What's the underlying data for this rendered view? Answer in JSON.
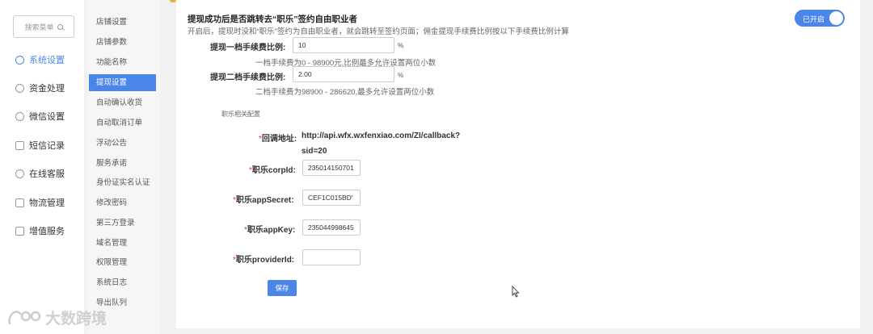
{
  "sidebar": {
    "search_placeholder": "搜索菜单",
    "items": [
      {
        "label": "系统设置",
        "icon": "gear-icon"
      },
      {
        "label": "资金处理",
        "icon": "money-icon"
      },
      {
        "label": "微信设置",
        "icon": "wechat-icon"
      },
      {
        "label": "短信记录",
        "icon": "message-icon"
      },
      {
        "label": "在线客服",
        "icon": "headset-icon"
      },
      {
        "label": "物流管理",
        "icon": "truck-icon"
      },
      {
        "label": "增值服务",
        "icon": "chart-icon"
      }
    ]
  },
  "submenu": {
    "items": [
      "店铺设置",
      "店铺参数",
      "功能名称",
      "提现设置",
      "自动确认收货",
      "自动取消订单",
      "浮动公告",
      "服务承诺",
      "身份证实名认证",
      "修改密码",
      "第三方登录",
      "域名管理",
      "权限管理",
      "系统日志",
      "导出队列"
    ]
  },
  "form": {
    "title": "提现成功后是否跳转去“职乐”签约自由职业者",
    "description": "开启后，提现时没和“职乐”签约为自由职业者，就会跳转至签约页面；佣金提现手续费比例按以下手续费比例计算",
    "toggle_label": "已开启",
    "fee1_label": "提现一档手续费比例:",
    "fee1_value": "10",
    "fee1_unit": "%",
    "fee1_hint": "一档手续费为0 - 98900元,比例最多允许设置两位小数",
    "fee2_label": "提现二档手续费比例:",
    "fee2_value": "2.00",
    "fee2_unit": "%",
    "fee2_hint": "二档手续费为98900 - 286620,最多允许设置两位小数",
    "section_label": "职乐相关配置",
    "callback_label": "回调地址:",
    "callback_url_line1": "http://api.wfx.wxfenxiao.com/ZI/callback?",
    "callback_url_line2": "sid=20",
    "corpid_label": "职乐corpId:",
    "corpid_value": "235014150701",
    "appsecret_label": "职乐appSecret:",
    "appsecret_value": "CEF1C015BD'",
    "appkey_label": "职乐appKey:",
    "appkey_value": "235044998645",
    "providerid_label": "职乐providerId:",
    "providerid_value": "",
    "save_label": "保存"
  },
  "watermark": "大数跨境"
}
